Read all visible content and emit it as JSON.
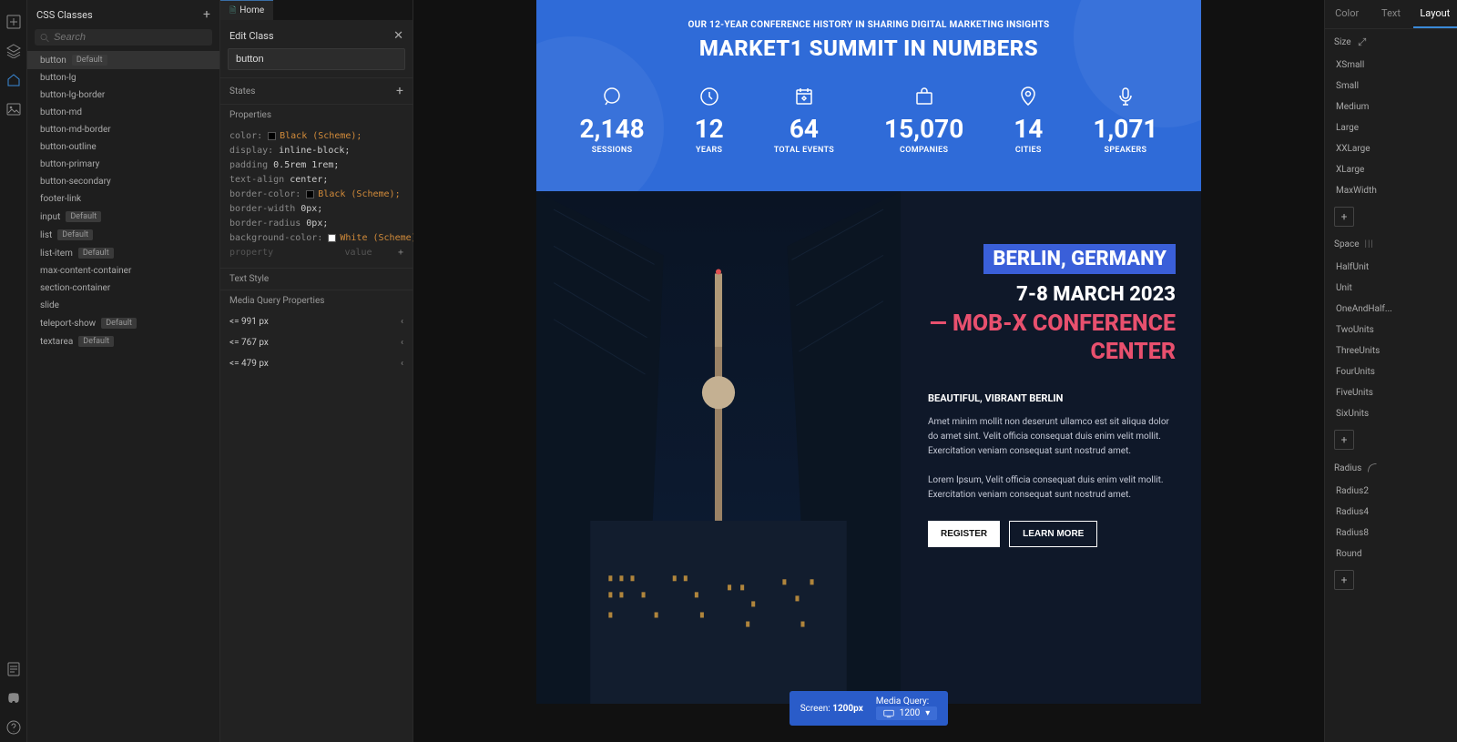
{
  "leftPanel": {
    "title": "CSS Classes",
    "searchPlaceholder": "Search",
    "items": [
      {
        "name": "button",
        "tag": "Default",
        "active": true
      },
      {
        "name": "button-lg"
      },
      {
        "name": "button-lg-border"
      },
      {
        "name": "button-md"
      },
      {
        "name": "button-md-border"
      },
      {
        "name": "button-outline"
      },
      {
        "name": "button-primary"
      },
      {
        "name": "button-secondary"
      },
      {
        "name": "footer-link"
      },
      {
        "name": "input",
        "tag": "Default"
      },
      {
        "name": "list",
        "tag": "Default"
      },
      {
        "name": "list-item",
        "tag": "Default"
      },
      {
        "name": "max-content-container"
      },
      {
        "name": "section-container"
      },
      {
        "name": "slide"
      },
      {
        "name": "teleport-show",
        "tag": "Default"
      },
      {
        "name": "textarea",
        "tag": "Default"
      }
    ]
  },
  "tab": {
    "label": "Home"
  },
  "editPanel": {
    "title": "Edit Class",
    "nameValue": "button",
    "statesLabel": "States",
    "propertiesLabel": "Properties",
    "props": [
      {
        "k": "color:",
        "swatch": "black",
        "v": "Black (Scheme);"
      },
      {
        "k": "display:",
        "v": "inline-block;"
      },
      {
        "k": "padding",
        "v": "0.5rem 1rem;"
      },
      {
        "k": "text-align",
        "v": "center;"
      },
      {
        "k": "border-color:",
        "swatch": "black",
        "v": "Black (Scheme);"
      },
      {
        "k": "border-width",
        "v": "0px;"
      },
      {
        "k": "border-radius",
        "v": "0px;"
      },
      {
        "k": "background-color:",
        "swatch": "white",
        "v": "White (Scheme);"
      }
    ],
    "emptyProp": "property",
    "emptyVal": "value",
    "textStyleLabel": "Text Style",
    "mediaQueryLabel": "Media Query Properties",
    "mediaQueries": [
      "<= 991 px",
      "<= 767 px",
      "<= 479 px"
    ]
  },
  "canvas": {
    "eyebrow": "OUR 12-YEAR CONFERENCE HISTORY IN SHARING DIGITAL MARKETING INSIGHTS",
    "title": "MARKET1 SUMMIT IN NUMBERS",
    "stats": [
      {
        "num": "2,148",
        "label": "SESSIONS"
      },
      {
        "num": "12",
        "label": "YEARS"
      },
      {
        "num": "64",
        "label": "TOTAL EVENTS"
      },
      {
        "num": "15,070",
        "label": "COMPANIES"
      },
      {
        "num": "14",
        "label": "CITIES"
      },
      {
        "num": "1,071",
        "label": "SPEAKERS"
      }
    ],
    "location": "BERLIN, GERMANY",
    "date": "7-8 MARCH 2023",
    "venue": "— MOB-X CONFERENCE CENTER",
    "subhead": "BEAUTIFUL, VIBRANT BERLIN",
    "body1": "Amet minim mollit non deserunt ullamco est sit aliqua dolor do amet sint. Velit officia consequat duis enim velit mollit. Exercitation veniam consequat sunt nostrud amet.",
    "body2": "Lorem Ipsum, Velit officia consequat duis enim velit mollit. Exercitation veniam consequat sunt nostrud amet.",
    "registerBtn": "REGISTER",
    "learnBtn": "LEARN MORE"
  },
  "bottomBar": {
    "screenLabel": "Screen:",
    "screenVal": "1200px",
    "mqLabel": "Media Query:",
    "mqVal": "1200"
  },
  "rightPanel": {
    "tabs": [
      "Color",
      "Text",
      "Layout"
    ],
    "activeTab": 2,
    "sizeHeader": "Size",
    "sizes": [
      "XSmall",
      "Small",
      "Medium",
      "Large",
      "XXLarge",
      "XLarge",
      "MaxWidth"
    ],
    "spaceHeader": "Space",
    "spaces": [
      "HalfUnit",
      "Unit",
      "OneAndHalf...",
      "TwoUnits",
      "ThreeUnits",
      "FourUnits",
      "FiveUnits",
      "SixUnits"
    ],
    "radiusHeader": "Radius",
    "radii": [
      "Radius2",
      "Radius4",
      "Radius8",
      "Round"
    ]
  }
}
